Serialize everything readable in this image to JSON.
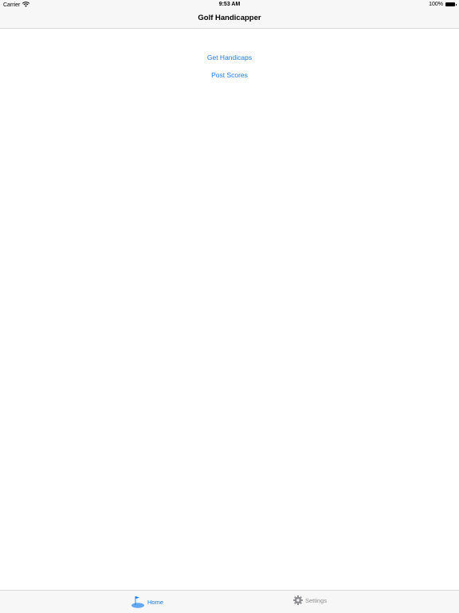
{
  "status_bar": {
    "carrier": "Carrier",
    "time": "9:53 AM",
    "battery_percent": "100%",
    "battery_level": 1.0,
    "wifi_icon": "wifi-icon",
    "battery_icon": "battery-icon"
  },
  "nav_bar": {
    "title": "Golf Handicapper"
  },
  "main": {
    "get_handicaps_label": "Get Handicaps",
    "post_scores_label": "Post Scores"
  },
  "tab_bar": {
    "tabs": [
      {
        "label": "Home",
        "icon": "golf-flag-icon",
        "selected": true
      },
      {
        "label": "Settings",
        "icon": "gear-icon",
        "selected": false
      }
    ]
  },
  "colors": {
    "accent": "#1a7bf0",
    "inactive_tab": "#8e8e93",
    "bar_background": "#f7f7f7",
    "separator": "#d8d8d8"
  }
}
